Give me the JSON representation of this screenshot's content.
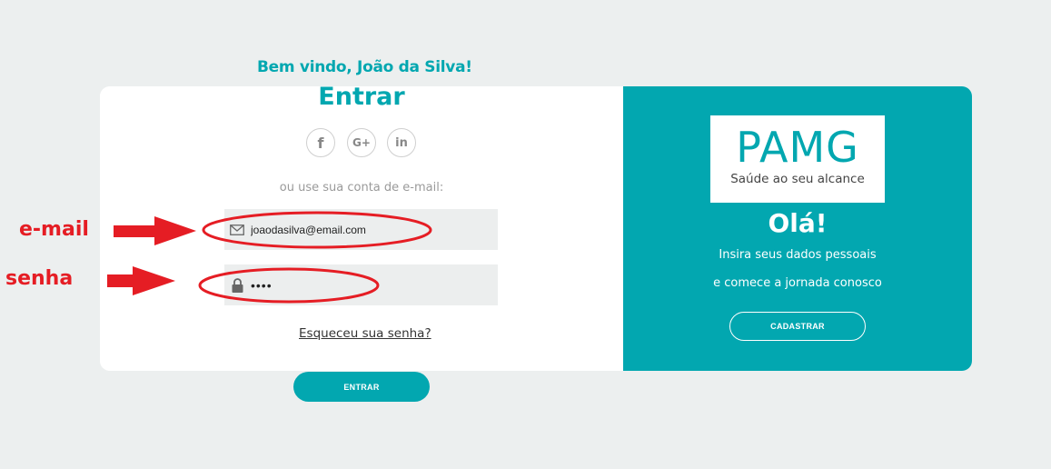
{
  "welcome_text": "Bem vindo, João da Silva!",
  "login": {
    "title": "Entrar",
    "social": [
      {
        "label": "f",
        "icon": "facebook-icon"
      },
      {
        "label": "G+",
        "icon": "google-plus-icon"
      },
      {
        "label": "in",
        "icon": "linkedin-icon"
      }
    ],
    "subtitle": "ou use sua conta de e-mail:",
    "email_value": "joaodasilva@email.com",
    "email_icon": "envelope-icon",
    "password_value": "••••",
    "password_icon": "lock-icon",
    "forgot_link": "Esqueceu sua senha?",
    "submit_label": "ENTRAR"
  },
  "signup": {
    "logo_text": "PAMG",
    "logo_tagline": "Saúde ao seu alcance",
    "heading": "Olá!",
    "line1": "Insira seus dados pessoais",
    "line2": "e comece a jornada conosco",
    "button_label": "CADASTRAR"
  },
  "annotations": {
    "email_label": "e-mail",
    "senha_label": "senha",
    "color": "#e51d24"
  },
  "colors": {
    "accent": "#02a7b0",
    "background": "#ecefef",
    "field_bg": "#eceeee"
  }
}
